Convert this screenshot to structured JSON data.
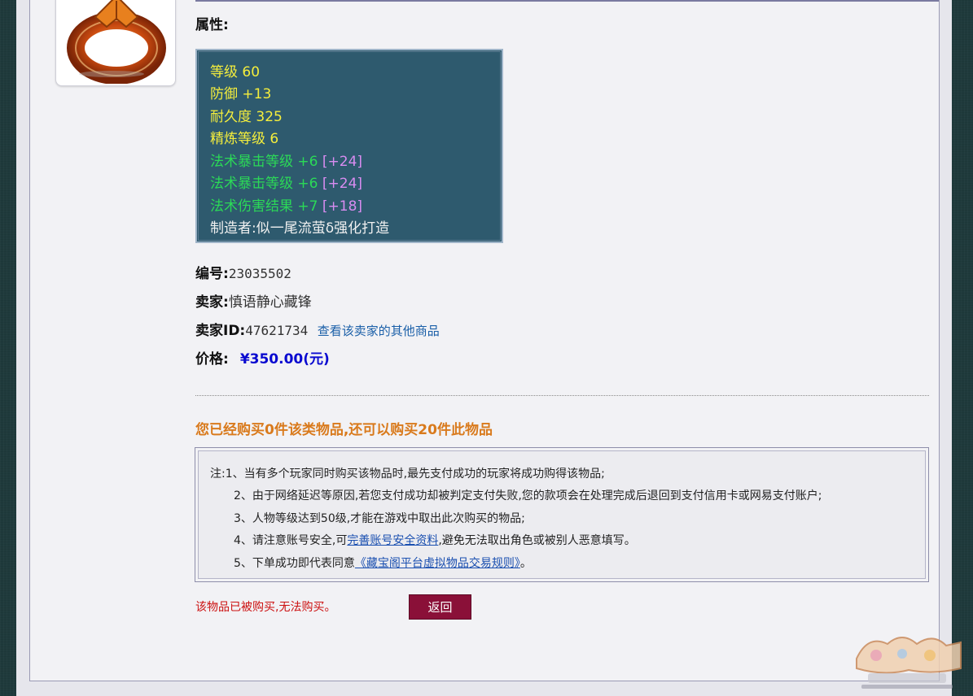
{
  "attributes": {
    "title": "属性:",
    "lines": [
      {
        "text": "等级 60",
        "color": "#f5ee3c"
      },
      {
        "text": "防御 +13",
        "color": "#f5ee3c"
      },
      {
        "text": "耐久度 325",
        "color": "#f5ee3c"
      },
      {
        "text": "精炼等级 6",
        "color": "#f5ee3c"
      },
      {
        "text": "法术暴击等级 +6",
        "bonus": "[+24]",
        "color": "#2bd957"
      },
      {
        "text": "法术暴击等级 +6",
        "bonus": "[+24]",
        "color": "#2bd957"
      },
      {
        "text": "法术伤害结果 +7",
        "bonus": "[+18]",
        "color": "#2bd957"
      },
      {
        "text": "制造者:似一尾流萤δ强化打造",
        "color": "#f1f1f1"
      }
    ]
  },
  "info": {
    "serial_label": "编号:",
    "serial_value": "23035502",
    "seller_label": "卖家:",
    "seller_value": "慎语静心藏锋",
    "seller_id_label": "卖家ID:",
    "seller_id_value": "47621734",
    "seller_link": "查看该卖家的其他商品",
    "price_label": "价格:",
    "price_value": "¥350.00(元)"
  },
  "purchase": {
    "bought_message": "您已经购买0件该类物品,还可以购买20件此物品",
    "notes": {
      "line1": "注:1、当有多个玩家同时购买该物品时,最先支付成功的玩家将成功购得该物品;",
      "line2": "2、由于网络延迟等原因,若您支付成功却被判定支付失败,您的款项会在处理完成后退回到支付信用卡或网易支付账户;",
      "line3": "3、人物等级达到50级,才能在游戏中取出此次购买的物品;",
      "line4_pre": "4、请注意账号安全,可",
      "line4_link": "完善账号安全资料",
      "line4_post": ",避免无法取出角色或被别人恶意填写。",
      "line5_pre": "5、下单成功即代表同意",
      "line5_link": "《藏宝阁平台虚拟物品交易规则》",
      "line5_post": "。"
    },
    "sold_message": "该物品已被购买,无法购买。",
    "back_label": "返回"
  },
  "colors": {
    "accent_orange": "#d97a1c",
    "price_blue": "#0a0ad0",
    "button_maroon": "#8a1038",
    "attr_bg": "#2e5a6e"
  }
}
